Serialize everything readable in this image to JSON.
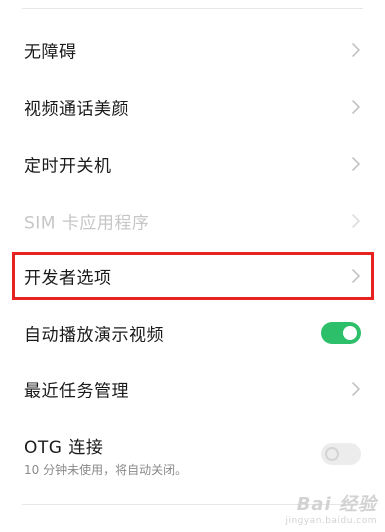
{
  "settings": {
    "items": [
      {
        "label": "无障碍",
        "type": "chevron",
        "disabled": false
      },
      {
        "label": "视频通话美颜",
        "type": "chevron",
        "disabled": false
      },
      {
        "label": "定时开关机",
        "type": "chevron",
        "disabled": false
      },
      {
        "label": "SIM 卡应用程序",
        "type": "chevron",
        "disabled": true
      },
      {
        "label": "开发者选项",
        "type": "chevron",
        "disabled": false,
        "highlighted": true
      },
      {
        "label": "自动播放演示视频",
        "type": "toggle",
        "state": "on"
      },
      {
        "label": "最近任务管理",
        "type": "chevron",
        "disabled": false
      },
      {
        "label": "OTG 连接",
        "subtitle": "10 分钟未使用，将自动关闭。",
        "type": "toggle",
        "state": "off"
      }
    ]
  },
  "watermark": {
    "logo": "Bai 经验",
    "url": "jingyan.baidu.com"
  },
  "colors": {
    "toggle_on": "#2dbf6a",
    "highlight_box": "#e8231f",
    "disabled_text": "#c6c6c6",
    "subtitle_text": "#8a8a8a"
  },
  "icons": {
    "chevron": "chevron-right-icon"
  }
}
